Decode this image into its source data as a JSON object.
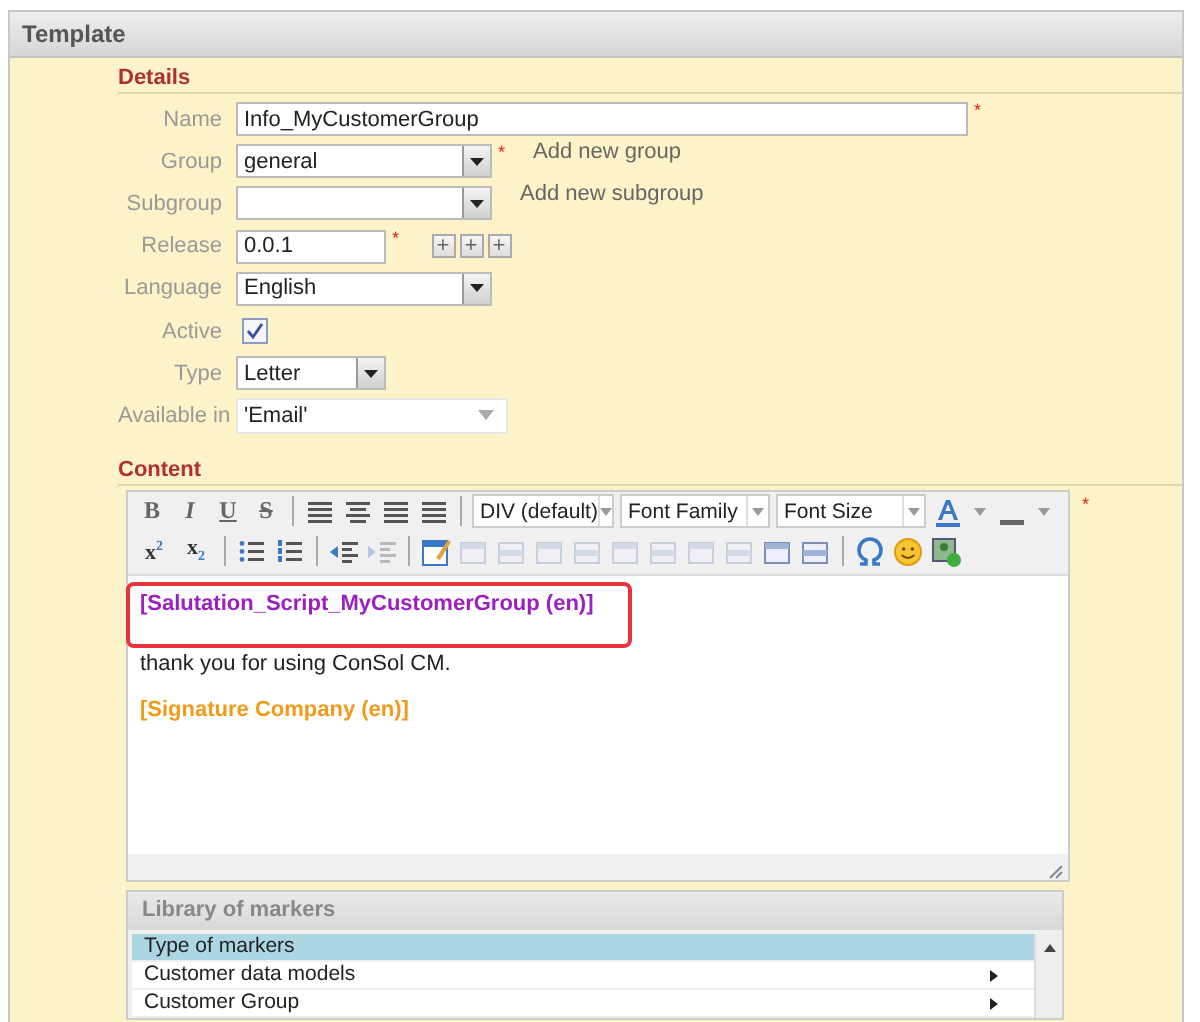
{
  "panel": {
    "title": "Template"
  },
  "details": {
    "heading": "Details",
    "fields": [
      {
        "kind": "longtext",
        "label": "Name",
        "value": "Info_MyCustomerGroup",
        "required_mark": "*"
      },
      {
        "kind": "select",
        "label": "Group",
        "value": "general",
        "required_mark": "*",
        "link": "Add new group"
      },
      {
        "kind": "select",
        "label": "Subgroup",
        "link": "Add new subgroup"
      },
      {
        "kind": "shorttext",
        "label": "Release",
        "value": "0.0.1",
        "required_mark": "*",
        "buttons": [
          "+",
          "+",
          "+"
        ]
      },
      {
        "kind": "select",
        "label": "Language",
        "value": "English"
      },
      {
        "kind": "checkbox",
        "label": "Active",
        "checked": true
      },
      {
        "kind": "shortselect",
        "label": "Type",
        "value": "Letter"
      },
      {
        "kind": "multiselect",
        "label": "Available in",
        "value": "'Email'"
      }
    ]
  },
  "content": {
    "heading": "Content",
    "required_mark": "*",
    "format_buttons": [
      {
        "kind": "bold",
        "label": "B"
      },
      {
        "kind": "italic",
        "label": "I"
      },
      {
        "kind": "underline",
        "label": "U"
      },
      {
        "kind": "strike",
        "label": "S"
      }
    ],
    "dropdowns": [
      "DIV (default)",
      "Font Family",
      "Font Size"
    ],
    "script_buttons": [
      "x$^{2}$",
      "x$_{2}$"
    ],
    "body": [
      {
        "kind": "marker",
        "text": "[Salutation_Script_MyCustomerGroup (en)]",
        "color": "#9b1fc1",
        "highlighted": true
      },
      {
        "kind": "plain",
        "text": "thank you for using ConSol CM."
      },
      {
        "kind": "marker",
        "text": "[Signature Company (en)]",
        "color": "#f39a1b",
        "highlighted": false
      }
    ]
  },
  "library": {
    "title": "Library of markers",
    "items": [
      {
        "label": "Type of markers",
        "selected": true,
        "has_submenu": false
      },
      {
        "label": "Customer data models",
        "selected": false,
        "has_submenu": true
      },
      {
        "label": "Customer Group",
        "selected": false,
        "has_submenu": true
      }
    ]
  }
}
